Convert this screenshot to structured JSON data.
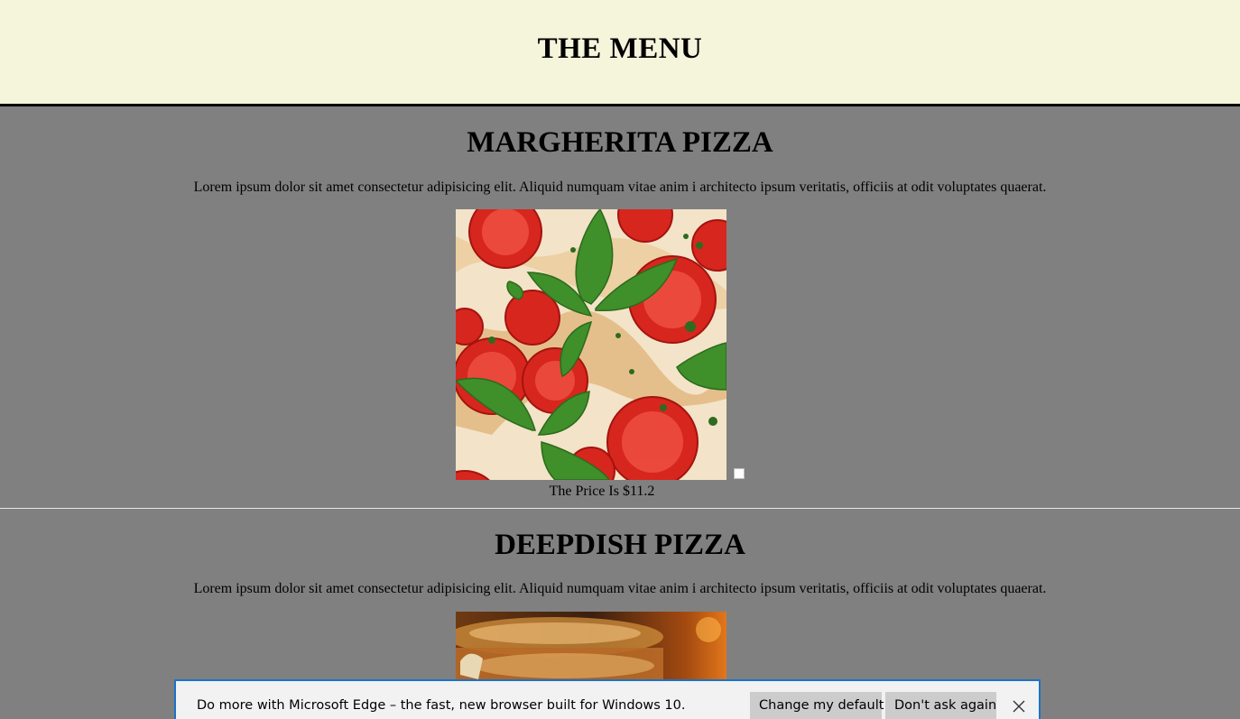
{
  "header": {
    "title": "THE MENU"
  },
  "items": [
    {
      "name": "MARGHERITA PIZZA",
      "description": "Lorem ipsum dolor sit amet consectetur adipisicing elit. Aliquid numquam vitae anim i architecto ipsum veritatis, officiis at odit voluptates quaerat.",
      "price": "The Price Is $11.2"
    },
    {
      "name": "DEEPDISH PIZZA",
      "description": "Lorem ipsum dolor sit amet consectetur adipisicing elit. Aliquid numquam vitae anim i architecto ipsum veritatis, officiis at odit voluptates quaerat."
    }
  ],
  "edge_bar": {
    "message": "Do more with Microsoft Edge – the fast, new browser built for Windows 10.",
    "change_default_label": "Change my default",
    "dont_ask_label": "Don't ask again",
    "close_icon": "close-icon"
  },
  "colors": {
    "header_bg": "#f5f5dc",
    "page_bg": "#808080",
    "edge_accent": "#1a73c9"
  }
}
